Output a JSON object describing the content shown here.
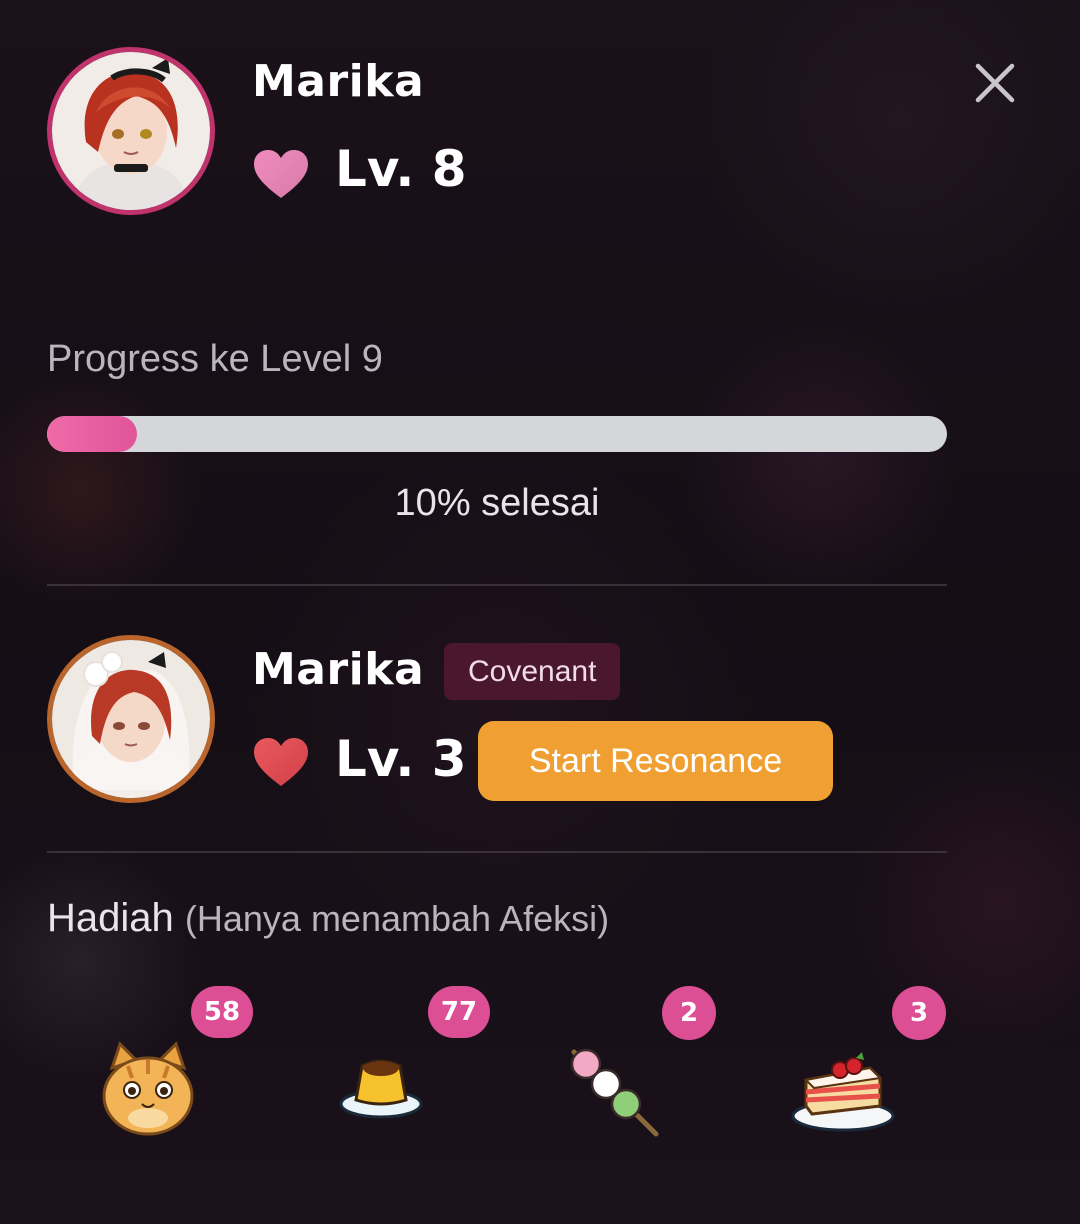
{
  "current_character": {
    "name": "Marika",
    "level_label": "Lv. 8"
  },
  "progress": {
    "label": "Progress ke Level 9",
    "percent": 10,
    "status_text": "10% selesai"
  },
  "covenant_character": {
    "name": "Marika",
    "tag": "Covenant",
    "level_label": "Lv. 3",
    "action_label": "Start Resonance"
  },
  "gifts": {
    "title": "Hadiah",
    "subtitle": "(Hanya menambah Afeksi)",
    "items": [
      {
        "icon": "cat-gift-icon",
        "count": "58"
      },
      {
        "icon": "pudding-gift-icon",
        "count": "77"
      },
      {
        "icon": "dango-gift-icon",
        "count": "2"
      },
      {
        "icon": "cake-gift-icon",
        "count": "3"
      }
    ]
  },
  "colors": {
    "background": "#17101a",
    "progress_fill": "#e0559a",
    "progress_track": "#d4d6d9",
    "resonance_button": "#f0a033",
    "badge": "#dd4f95",
    "heart_pink": "#e783b4",
    "heart_red": "#e0464e"
  }
}
